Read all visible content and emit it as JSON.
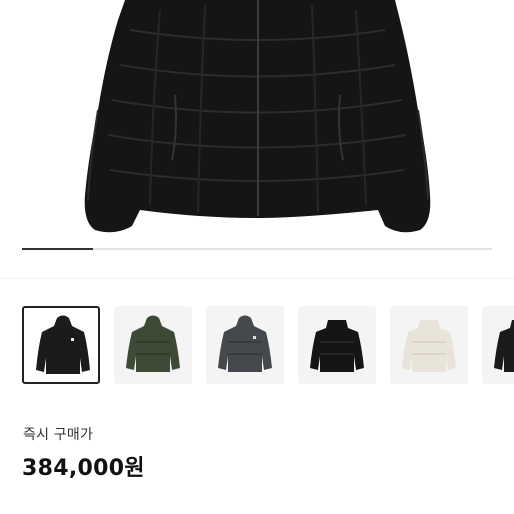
{
  "product": {
    "hero_image": "black-puffer-jacket",
    "gallery_progress": 0.15,
    "thumbnails": [
      {
        "name": "black-hooded-jacket",
        "color": "#1b1b1b",
        "selected": true
      },
      {
        "name": "olive-hooded-jacket",
        "color": "#3e4a35",
        "selected": false
      },
      {
        "name": "charcoal-hooded-jacket",
        "color": "#45484c",
        "selected": false
      },
      {
        "name": "black-collar-jacket",
        "color": "#151515",
        "selected": false
      },
      {
        "name": "ivory-collar-jacket",
        "color": "#e9e4d9",
        "selected": false
      },
      {
        "name": "black-jacket-partial",
        "color": "#1a1a1a",
        "selected": false
      }
    ],
    "price_label": "즉시 구매가",
    "price": "384,000원"
  },
  "colors": {
    "progress_fill": "#333333",
    "progress_track": "#e4e4e4"
  }
}
